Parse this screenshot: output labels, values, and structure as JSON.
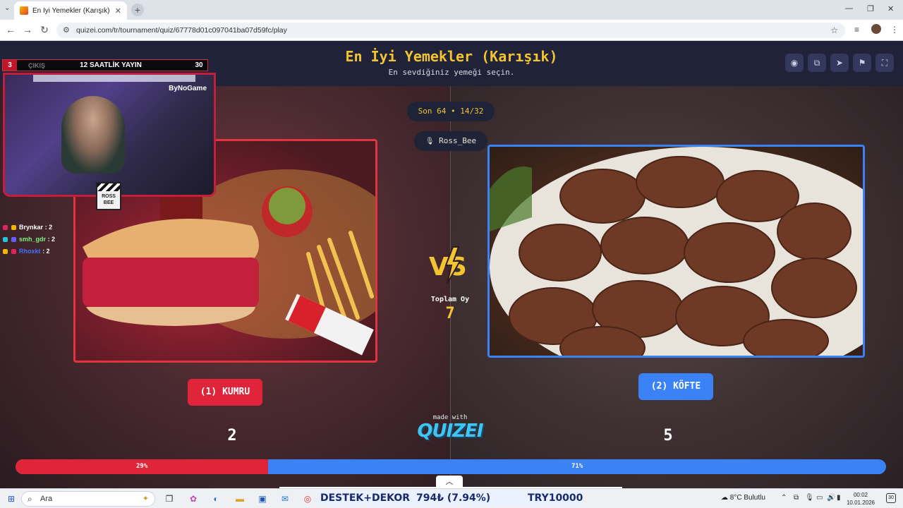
{
  "browser": {
    "tab_title": "En İyi Yemekler (Karışık) - Tier L",
    "tab_close": "✕",
    "new_tab": "+",
    "url": "quizei.com/tr/tournament/quiz/67778d01c097041ba07d59fc/play"
  },
  "header": {
    "title": "En İyi Yemekler (Karışık)",
    "subtitle": "En sevdiğiniz yemeği seçin.",
    "buttons": [
      "eye-icon",
      "share-icon",
      "send-icon",
      "flag-icon",
      "fullscreen-icon"
    ]
  },
  "round": {
    "label": "Son 64 • 14/32",
    "user": "Ross_Bee",
    "user_icon": "🎙"
  },
  "options": {
    "left": {
      "label": "(1) KUMRU",
      "votes": "2",
      "percent_label": "29%",
      "percent": 29,
      "color": "#e0243a"
    },
    "right": {
      "label": "(2) KÖFTE",
      "votes": "5",
      "percent_label": "71%",
      "percent": 71,
      "color": "#3b82f6"
    }
  },
  "total": {
    "label": "Toplam Oy",
    "value": "7"
  },
  "branding": {
    "made_with": "made with",
    "logo": "QUIZEI"
  },
  "overlay": {
    "score_left": "3",
    "exit_label": "ÇIKIŞ",
    "stream_title": "12 SAATLİK YAYIN",
    "score_right": "30",
    "cam_brand": "ByNoGame",
    "badge": "ROSS BEE",
    "leaderboard": [
      {
        "name": "Brynkar",
        "score": ": 2",
        "color": "#ffffff"
      },
      {
        "name": "smh_gdr",
        "score": ": 2",
        "color": "#7ef07a"
      },
      {
        "name": "Rhoxkt",
        "score": ": 2",
        "color": "#4a6dff"
      }
    ]
  },
  "taskbar": {
    "search_placeholder": "Ara",
    "ticker_1": "DESTEK+DEKOR",
    "ticker_2": "794₺ (7.94%)",
    "ticker_3": "TRY10000",
    "weather": "8°C Bulutlu",
    "time": "00:02",
    "date": "10.01.2026",
    "notifications": "30"
  }
}
